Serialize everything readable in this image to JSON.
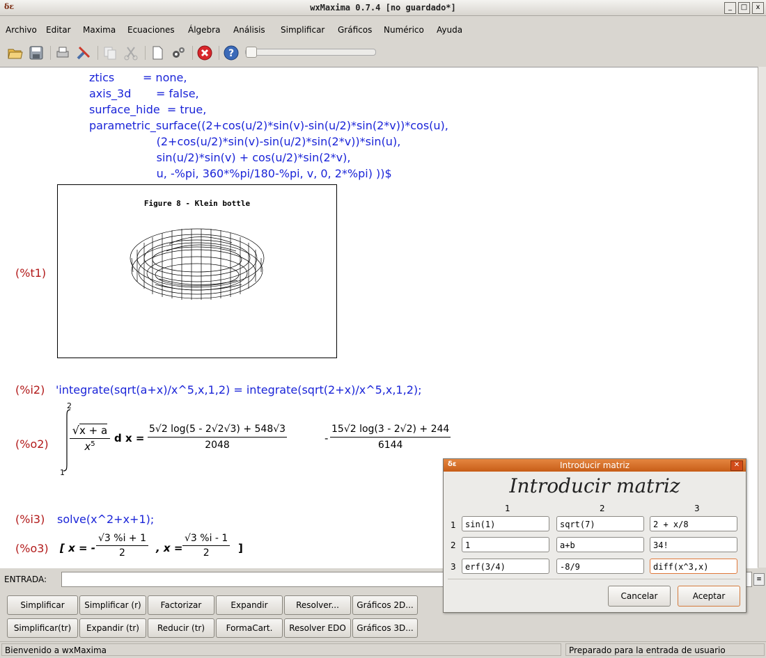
{
  "window": {
    "title": "wxMaxima 0.7.4 [no guardado*]",
    "logo": "δε",
    "minimize": "_",
    "maximize": "□",
    "close": "x"
  },
  "menu": [
    "Archivo",
    "Editar",
    "Maxima",
    "Ecuaciones",
    "Álgebra",
    "Análisis",
    "Simplificar",
    "Gráficos",
    "Numérico",
    "Ayuda"
  ],
  "worksheet": {
    "code_lines": [
      "ztics        = none,",
      "axis_3d       = false,",
      "surface_hide  = true,",
      "parametric_surface((2+cos(u/2)*sin(v)-sin(u/2)*sin(2*v))*cos(u),",
      "                   (2+cos(u/2)*sin(v)-sin(u/2)*sin(2*v))*sin(u),",
      "                   sin(u/2)*sin(v) + cos(u/2)*sin(2*v),",
      "                   u, -%pi, 360*%pi/180-%pi, v, 0, 2*%pi) ))$"
    ],
    "t1_label": "(%t1)",
    "plot_title": "Figure 8 - Klein bottle",
    "i2_label": "(%i2)",
    "i2_input": "'integrate(sqrt(a+x)/x^5,x,1,2) = integrate(sqrt(2+x)/x^5,x,1,2);",
    "o2_label": "(%o2)",
    "o2": {
      "upper": "2",
      "lower": "1",
      "integrand_num": "x + a",
      "integrand_den": "x",
      "integrand_den_exp": "5",
      "dx": "d x =",
      "frac1_num": "5√2 log(5 - 2√2√3) + 548√3",
      "frac1_den": "2048",
      "minus": "-",
      "frac2_num": "15√2 log(3 - 2√2) + 244",
      "frac2_den": "6144"
    },
    "i3_label": "(%i3)",
    "i3_input": "solve(x^2+x+1);",
    "o3_label": "(%o3)",
    "o3": {
      "open": "[ x = -",
      "f1_num": "√3 %i + 1",
      "f1_den": "2",
      "mid": ", x =",
      "f2_num": "√3 %i - 1",
      "f2_den": "2",
      "close": "]"
    }
  },
  "entrada": {
    "label": "ENTRADA:",
    "value": ""
  },
  "buttons_row1": [
    "Simplificar",
    "Simplificar (r)",
    "Factorizar",
    "Expandir",
    "Resolver...",
    "Gráficos 2D..."
  ],
  "buttons_row2": [
    "Simplificar(tr)",
    "Expandir (tr)",
    "Reducir (tr)",
    "FormaCart.",
    "Resolver EDO",
    "Gráficos 3D..."
  ],
  "status": {
    "left": "Bienvenido a wxMaxima",
    "right": "Preparado para la entrada de usuario"
  },
  "dialog": {
    "title": "Introducir matriz",
    "heading": "Introducir matriz",
    "col_headers": [
      "1",
      "2",
      "3"
    ],
    "row_headers": [
      "1",
      "2",
      "3"
    ],
    "cells": [
      [
        "sin(1)",
        "sqrt(7)",
        "2 + x/8"
      ],
      [
        "1",
        "a+b",
        "34!"
      ],
      [
        "erf(3/4)",
        "-8/9",
        "diff(x^3,x)"
      ]
    ],
    "cancel": "Cancelar",
    "accept": "Aceptar"
  }
}
